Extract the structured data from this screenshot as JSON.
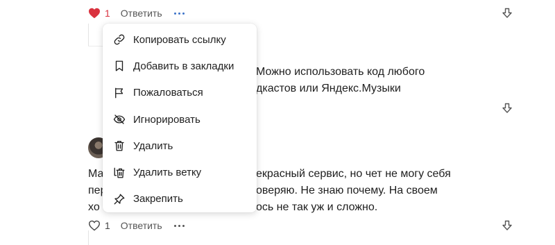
{
  "top_comment": {
    "likes": "1",
    "reply_label": "Ответить",
    "text_lines": [
      "Можно использовать код любого",
      "дкастов или Яндекс.Музыки"
    ]
  },
  "context_menu": {
    "items": [
      {
        "label": "Копировать ссылку",
        "icon": "link-icon"
      },
      {
        "label": "Добавить в закладки",
        "icon": "bookmark-icon"
      },
      {
        "label": "Пожаловаться",
        "icon": "flag-icon"
      },
      {
        "label": "Игнорировать",
        "icon": "eye-off-icon"
      },
      {
        "label": "Удалить",
        "icon": "trash-icon"
      },
      {
        "label": "Удалить ветку",
        "icon": "trash-branch-icon"
      },
      {
        "label": "Закрепить",
        "icon": "pin-icon"
      }
    ]
  },
  "second_comment": {
    "text_left": [
      "Ма",
      "пер",
      "хо"
    ],
    "text_right": [
      "екрасный сервис, но чет не могу себя",
      "оверяю. Не знаю почему. На своем",
      "ось не так уж и сложно."
    ],
    "likes": "1",
    "reply_label": "Ответить"
  },
  "colors": {
    "like_active": "#d9323f",
    "more_active": "#3d73c9"
  }
}
